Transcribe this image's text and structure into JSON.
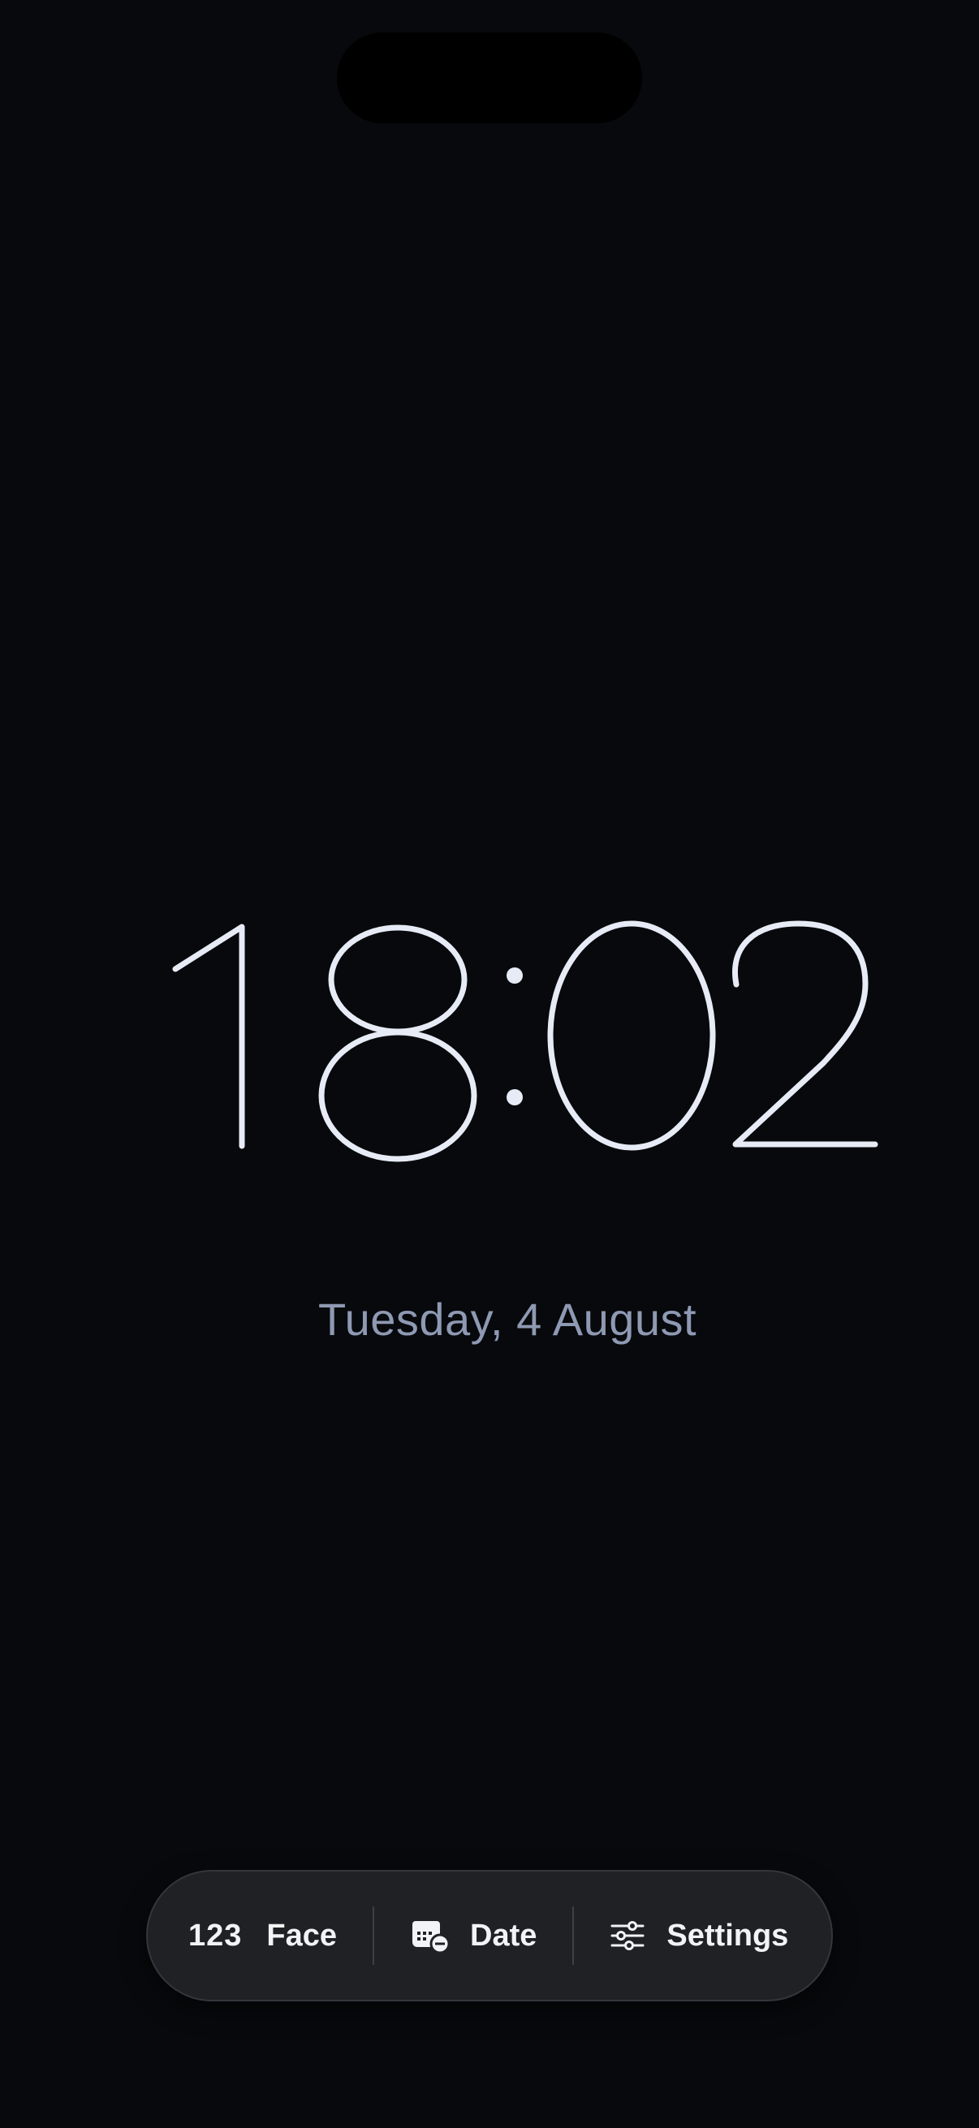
{
  "lock_screen": {
    "time": "18:02",
    "date": "Tuesday, 4 August"
  },
  "toolbar": {
    "face": {
      "prefix": "123",
      "label": "Face"
    },
    "date": {
      "icon": "calendar-icon",
      "label": "Date"
    },
    "settings": {
      "icon": "sliders-icon",
      "label": "Settings"
    }
  },
  "colors": {
    "background": "#08090c",
    "clock_stroke": "#e6ebf5",
    "date_text": "#8e99b3",
    "toolbar_bg": "#202124"
  }
}
